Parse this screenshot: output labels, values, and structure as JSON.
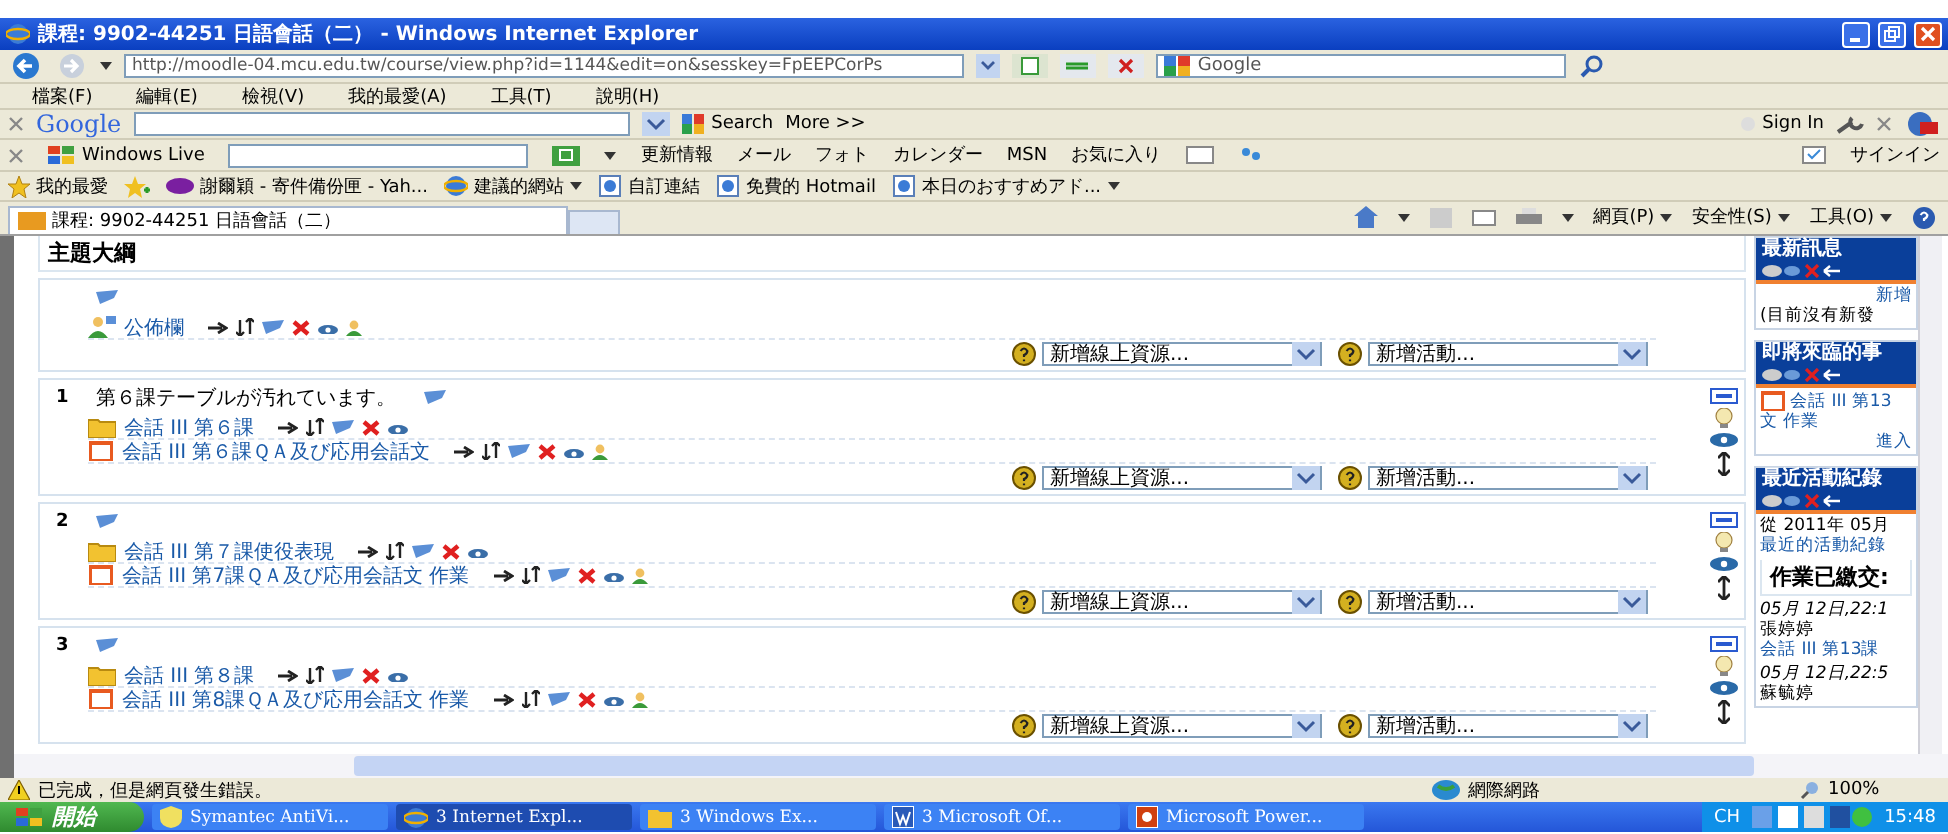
{
  "window": {
    "title": "課程: 9902-44251 日語會話（二） - Windows Internet Explorer"
  },
  "address": {
    "url": "http://moodle-04.mcu.edu.tw/course/view.php?id=1144&edit=on&sesskey=FpEEPCorPs",
    "search_placeholder": "Google"
  },
  "menu": [
    "檔案(F)",
    "編輯(E)",
    "檢視(V)",
    "我的最愛(A)",
    "工具(T)",
    "說明(H)"
  ],
  "google_toolbar": {
    "logo": "Google",
    "search": "Search",
    "more": "More >>",
    "sign_in": "Sign In"
  },
  "live_toolbar": {
    "label": "Windows Live",
    "links": [
      "更新情報",
      "メール",
      "フォト",
      "カレンダー",
      "MSN",
      "お気に入り"
    ],
    "sign_in": "サインイン"
  },
  "favorites": {
    "label": "我的最愛",
    "items": [
      {
        "kind": "yahoo",
        "text": "謝爾穎 - 寄件備份匣 - Yah...",
        "dropdown": false
      },
      {
        "kind": "ie",
        "text": "建議的網站",
        "dropdown": true
      },
      {
        "kind": "page",
        "text": "自訂連結",
        "dropdown": false
      },
      {
        "kind": "page",
        "text": "免費的 Hotmail",
        "dropdown": false
      },
      {
        "kind": "page",
        "text": "本日のおすすめアド...",
        "dropdown": true
      }
    ]
  },
  "tab": {
    "title": "課程: 9902-44251 日語會話（二）"
  },
  "command_bar": [
    "網頁(P)",
    "安全性(S)",
    "工具(O)"
  ],
  "course": {
    "heading": "主題大綱",
    "sections": [
      {
        "side_controls": false,
        "activities": [
          {
            "kind": "forum",
            "name": "公佈欄",
            "groups": true
          }
        ],
        "add_resource": "新增線上資源...",
        "add_activity": "新增活動..."
      },
      {
        "number": "1",
        "title": "第６課テーブルが汚れています。",
        "side_controls": true,
        "activities": [
          {
            "kind": "resource",
            "name": "会話 III 第６課",
            "groups": false
          },
          {
            "kind": "assignment",
            "name": "会話 III 第６課ＱＡ及び応用会話文",
            "groups": true
          }
        ],
        "add_resource": "新增線上資源...",
        "add_activity": "新增活動..."
      },
      {
        "number": "2",
        "side_controls": true,
        "activities": [
          {
            "kind": "resource",
            "name": "会話 III 第７課使役表現",
            "groups": false
          },
          {
            "kind": "assignment",
            "name": "会話 III 第7課ＱＡ及び応用会話文 作業",
            "groups": true
          }
        ],
        "add_resource": "新增線上資源...",
        "add_activity": "新增活動..."
      },
      {
        "number": "3",
        "side_controls": true,
        "activities": [
          {
            "kind": "resource",
            "name": "会話 III 第８課",
            "groups": false
          },
          {
            "kind": "assignment",
            "name": "会話 III 第8課ＱＡ及び応用会話文 作業",
            "groups": true
          }
        ],
        "add_resource": "新增線上資源...",
        "add_activity": "新增活動..."
      }
    ]
  },
  "sidebar": [
    {
      "title": "最新訊息",
      "lines": [
        {
          "kind": "link-right",
          "text": "新增"
        },
        {
          "kind": "text",
          "text": "(目前沒有新發"
        }
      ]
    },
    {
      "title": "即將來臨的事",
      "lines": [
        {
          "kind": "event",
          "text": "会話 III 第13"
        },
        {
          "kind": "link",
          "text": "文 作業"
        },
        {
          "kind": "link-right",
          "text": "進入"
        }
      ]
    },
    {
      "title": "最近活動紀錄",
      "lines": [
        {
          "kind": "text",
          "text": "從 2011年 05月"
        },
        {
          "kind": "link",
          "text": "最近的活動紀錄"
        },
        {
          "kind": "heading",
          "text": "作業已繳交:"
        },
        {
          "kind": "date",
          "text": "05月 12日,22:1"
        },
        {
          "kind": "text",
          "text": "張婷婷"
        },
        {
          "kind": "link",
          "text": "会話 III 第13課"
        },
        {
          "kind": "date",
          "text": "05月 12日,22:5"
        },
        {
          "kind": "text",
          "text": "蘇毓婷"
        }
      ]
    }
  ],
  "status_bar": {
    "message": "已完成，但是網頁發生錯誤。",
    "zone": "網際網路",
    "zoom": "100%"
  },
  "taskbar": {
    "start": "開始",
    "tasks": [
      {
        "kind": "shield",
        "text": "Symantec AntiVi...",
        "selected": false
      },
      {
        "kind": "ie",
        "text": "3 Internet Expl...",
        "selected": true
      },
      {
        "kind": "folder",
        "text": "3 Windows Ex...",
        "selected": false
      },
      {
        "kind": "word",
        "text": "3 Microsoft Of...",
        "selected": false
      },
      {
        "kind": "ppt",
        "text": "Microsoft Power...",
        "selected": false
      }
    ],
    "language": "CH",
    "clock": "15:48"
  }
}
